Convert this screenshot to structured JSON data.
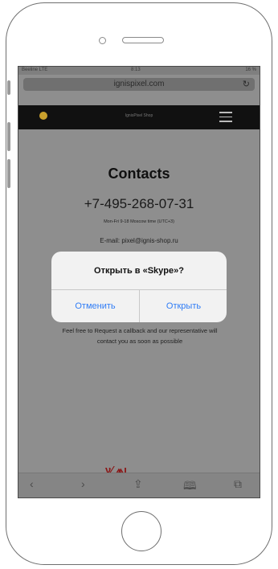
{
  "status_bar": {
    "carrier": "Beeline LTE",
    "time": "8:13",
    "battery": "16 %"
  },
  "url_bar": {
    "domain": "ignispixel.com",
    "reload_icon": "reload-icon"
  },
  "site_nav": {
    "name": "IgnisPixel Shop"
  },
  "contacts": {
    "title": "Contacts",
    "phone": "+7-495-268-07-31",
    "hours": "Mon-Fri 9-18 Moscow time (UTC+3)",
    "email": "E-mail: pixel@ignis-shop.ru",
    "blurb": "Feel free to Request a callback and our representative will contact you as soon as possible"
  },
  "dialog": {
    "message": "Открыть в «Skype»?",
    "cancel_label": "Отменить",
    "open_label": "Открыть"
  },
  "toolbar": {
    "back": "‹",
    "forward": "›",
    "share": "⇪",
    "bookmarks": "🕮",
    "tabs": "⧉"
  },
  "colors": {
    "dialog_accent": "#2f7cf6",
    "nav_bg": "#111111",
    "logo": "#c9a02d"
  }
}
